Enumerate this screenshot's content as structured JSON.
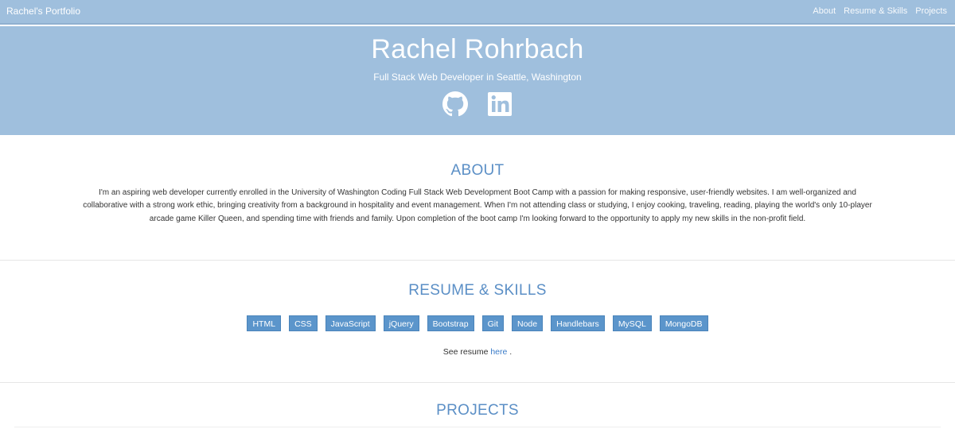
{
  "navbar": {
    "brand": "Rachel's Portfolio",
    "links": [
      "About",
      "Resume & Skills",
      "Projects"
    ]
  },
  "hero": {
    "name": "Rachel Rohrbach",
    "subtitle": "Full Stack Web Developer in Seattle, Washington",
    "social_icons": [
      "github-icon",
      "linkedin-icon"
    ]
  },
  "about": {
    "title": "ABOUT",
    "text": "I'm an aspiring web developer currently enrolled in the University of Washington Coding Full Stack Web Development Boot Camp with a passion for making responsive, user-friendly websites. I am well-organized and collaborative with a strong work ethic, bringing creativity from a background in hospitality and event management. When I'm not attending class or studying, I enjoy cooking, traveling, reading, playing the world's only 10-player arcade game Killer Queen, and spending time with friends and family. Upon completion of the boot camp I'm looking forward to the opportunity to apply my new skills in the non-profit field."
  },
  "skills": {
    "title": "RESUME & SKILLS",
    "items": [
      "HTML",
      "CSS",
      "JavaScript",
      "jQuery",
      "Bootstrap",
      "Git",
      "Node",
      "Handlebars",
      "MySQL",
      "MongoDB"
    ],
    "resume_prefix": "See resume",
    "resume_link": "here",
    "resume_suffix": "."
  },
  "projects": {
    "title": "PROJECTS"
  },
  "colors": {
    "hero_bg": "#9fbfdd",
    "accent": "#5b8fc6",
    "badge": "#5b95cb",
    "link": "#3a7bc8"
  }
}
